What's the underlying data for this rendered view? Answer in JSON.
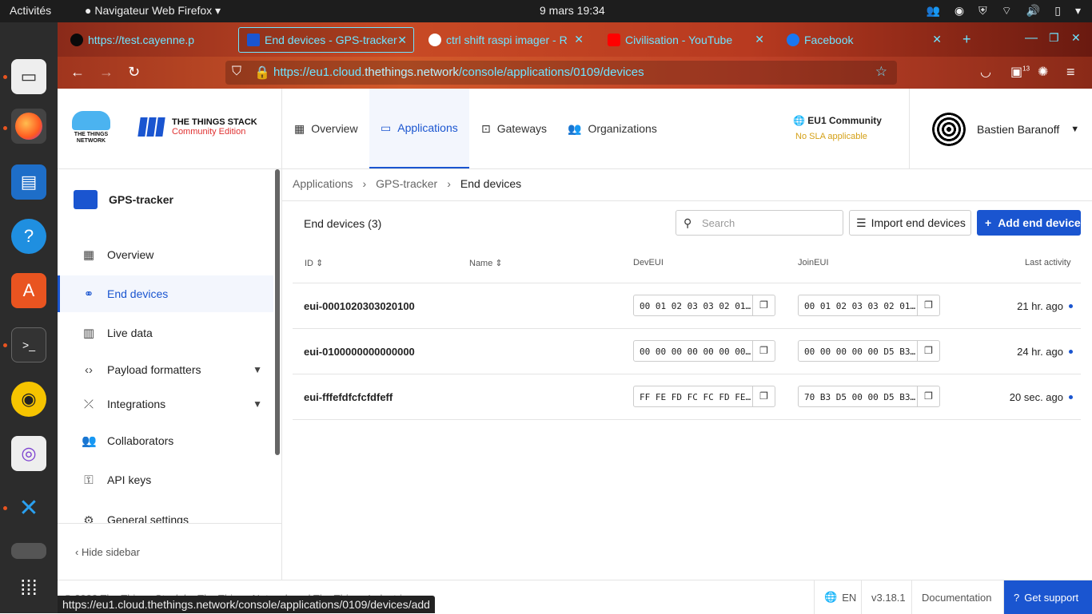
{
  "system": {
    "activities": "Activités",
    "app_name": "Navigateur Web Firefox",
    "clock": "9 mars  19:34"
  },
  "browser": {
    "tabs": [
      {
        "label": "https://test.cayenne.p",
        "color": "#0a0a0a"
      },
      {
        "label": "End devices - GPS-tracker",
        "color": "#1a55d0"
      },
      {
        "label": "ctrl shift raspi imager - R",
        "color": "#ffffff"
      },
      {
        "label": "Civilisation - YouTube",
        "color": "#ff0000"
      },
      {
        "label": "Facebook",
        "color": "#1877f2"
      }
    ],
    "url_host_pre": "https://eu1.cloud.",
    "url_host_main": "thethings.network",
    "url_path": "/console/applications/0109/devices",
    "notif_count": "13",
    "status_url": "https://eu1.cloud.thethings.network/console/applications/0109/devices/add"
  },
  "header": {
    "logo_ttn": "THE THINGS NETWORK",
    "logo_stack_1": "THE THINGS STACK",
    "logo_stack_2": "Community Edition",
    "nav": [
      "Overview",
      "Applications",
      "Gateways",
      "Organizations"
    ],
    "cluster": "EU1 Community",
    "sla": "No SLA applicable",
    "user": "Bastien Baranoff"
  },
  "sidebar": {
    "app_name": "GPS-tracker",
    "items": [
      {
        "label": "Overview",
        "icon": "▦"
      },
      {
        "label": "End devices",
        "icon": "⚭"
      },
      {
        "label": "Live data",
        "icon": "▥"
      },
      {
        "label": "Payload formatters",
        "icon": "‹›"
      },
      {
        "label": "Integrations",
        "icon": "⤫"
      },
      {
        "label": "Collaborators",
        "icon": "👥"
      },
      {
        "label": "API keys",
        "icon": "⚿"
      },
      {
        "label": "General settings",
        "icon": "⚙"
      }
    ],
    "hide": "Hide sidebar"
  },
  "main": {
    "breadcrumbs": [
      "Applications",
      "GPS-tracker",
      "End devices"
    ],
    "title": "End devices (3)",
    "search_placeholder": "Search",
    "import_label": "Import end devices",
    "add_label": "Add end device",
    "columns": [
      "ID",
      "Name",
      "DevEUI",
      "JoinEUI",
      "Last activity"
    ],
    "rows": [
      {
        "id": "eui-0001020303020100",
        "dev_eui": "00 01 02 03 03 02 01…",
        "join_eui": "00 01 02 03 03 02 01…",
        "last": "21 hr. ago"
      },
      {
        "id": "eui-0100000000000000",
        "dev_eui": "00 00 00 00 00 00 00…",
        "join_eui": "00 00 00 00 00 D5 B3…",
        "last": "24 hr. ago"
      },
      {
        "id": "eui-fffefdfcfcfdfeff",
        "dev_eui": "FF FE FD FC FC FD FE…",
        "join_eui": "70 B3 D5 00 00 D5 B3…",
        "last": "20 sec. ago"
      }
    ]
  },
  "footer": {
    "copyright": "© 2022 The Things Stack by The Things Network and The Things Industries",
    "lang": "EN",
    "version": "v3.18.1",
    "docs": "Documentation",
    "support": "Get support"
  }
}
